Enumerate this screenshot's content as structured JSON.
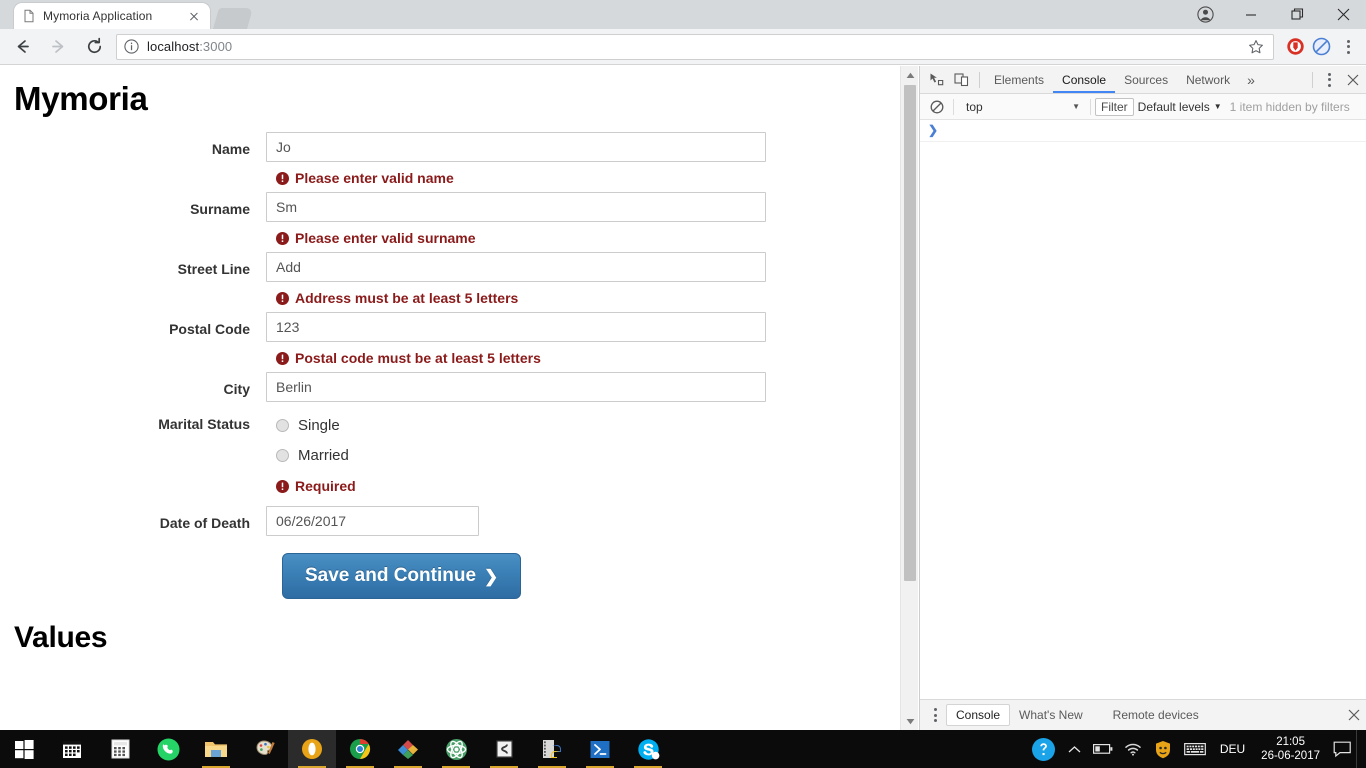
{
  "browser": {
    "tab": {
      "title": "Mymoria Application",
      "favicon_icon": "document-icon",
      "close_icon": "close-icon"
    },
    "new_tab_icon": "new-tab-icon",
    "window_controls": {
      "profile_icon": "profile-avatar-icon",
      "minimize_icon": "minimize-icon",
      "maximize_icon": "maximize-restore-icon",
      "close_icon": "window-close-icon"
    },
    "nav": {
      "back_icon": "back-arrow-icon",
      "forward_icon": "forward-arrow-icon",
      "reload_icon": "reload-icon"
    },
    "omnibox": {
      "info_icon": "page-info-icon",
      "url_host": "localhost",
      "url_port": ":3000",
      "bookmark_icon": "star-icon"
    },
    "extensions": [
      {
        "name": "adblock-extension-icon",
        "color": "#d93025"
      },
      {
        "name": "blocker-extension-icon",
        "color": "#4a7fd4"
      }
    ],
    "menu_icon": "chrome-menu-icon"
  },
  "page": {
    "title": "Mymoria",
    "section_title": "Values",
    "form": {
      "fields": [
        {
          "label": "Name",
          "value": "Jo",
          "error": "Please enter valid name",
          "type": "text"
        },
        {
          "label": "Surname",
          "value": "Sm",
          "error": "Please enter valid surname",
          "type": "text"
        },
        {
          "label": "Street Line",
          "value": "Add",
          "error": "Address must be at least 5 letters",
          "type": "text"
        },
        {
          "label": "Postal Code",
          "value": "123",
          "error": "Postal code must be at least 5 letters",
          "type": "text"
        },
        {
          "label": "City",
          "value": "Berlin",
          "error": "",
          "type": "text"
        }
      ],
      "marital": {
        "label": "Marital Status",
        "options": [
          {
            "label": "Single",
            "selected": false
          },
          {
            "label": "Married",
            "selected": false
          }
        ],
        "error": "Required"
      },
      "date_field": {
        "label": "Date of Death",
        "value": "06/26/2017"
      },
      "submit": {
        "label": "Save and Continue",
        "chevron": "❯"
      },
      "error_icon": "error-exclamation-icon"
    },
    "scrollbar": {
      "up_icon": "scroll-up-arrow-icon",
      "down_icon": "scroll-down-arrow-icon"
    }
  },
  "devtools": {
    "inspect_icon": "inspect-element-icon",
    "device_icon": "toggle-device-toolbar-icon",
    "tabs": [
      {
        "label": "Elements",
        "active": false
      },
      {
        "label": "Console",
        "active": true
      },
      {
        "label": "Sources",
        "active": false
      },
      {
        "label": "Network",
        "active": false
      }
    ],
    "more_tabs_icon": "chevron-double-right-icon",
    "settings_icon": "devtools-menu-icon",
    "close_icon": "devtools-close-icon",
    "console_bar": {
      "clear_icon": "clear-console-icon",
      "context": "top",
      "context_caret": "▼",
      "filter_placeholder": "Filter",
      "levels_label": "Default levels",
      "levels_caret": "▼",
      "hidden_message": "1 item hidden by filters"
    },
    "prompt_caret": "❯",
    "drawer": {
      "menu_icon": "drawer-menu-icon",
      "tabs": [
        {
          "label": "Console",
          "active": true
        },
        {
          "label": "What's New",
          "active": false
        },
        {
          "label": "Remote devices",
          "active": false
        }
      ],
      "close_icon": "drawer-close-icon"
    }
  },
  "taskbar": {
    "start_icon": "windows-start-icon",
    "apps": [
      {
        "name": "calendar-icon",
        "running": false,
        "active": false
      },
      {
        "name": "calculator-icon",
        "running": false,
        "active": false
      },
      {
        "name": "whatsapp-icon",
        "running": false,
        "active": false
      },
      {
        "name": "file-explorer-icon",
        "running": true,
        "active": false
      },
      {
        "name": "paint-icon",
        "running": false,
        "active": false
      },
      {
        "name": "browser-amber-icon",
        "running": true,
        "active": true
      },
      {
        "name": "google-chrome-icon",
        "running": true,
        "active": false
      },
      {
        "name": "diamond-app-icon",
        "running": true,
        "active": false
      },
      {
        "name": "atom-editor-icon",
        "running": true,
        "active": false
      },
      {
        "name": "sublime-text-icon",
        "running": true,
        "active": false
      },
      {
        "name": "python-app-icon",
        "running": true,
        "active": false
      },
      {
        "name": "powershell-icon",
        "running": true,
        "active": false
      },
      {
        "name": "skype-icon",
        "running": true,
        "active": false
      }
    ],
    "tray": {
      "help_icon": "help-question-icon",
      "expand_icon": "show-hidden-icons-icon",
      "battery_icon": "battery-icon",
      "wifi_icon": "wifi-icon",
      "firewall_icon": "firewall-shield-icon",
      "keyboard_icon": "keyboard-icon",
      "language": "DEU",
      "time": "21:05",
      "date": "26-06-2017",
      "notification_icon": "action-center-icon"
    }
  },
  "colors": {
    "error_red": "#8b1a1a",
    "button_blue": "#2e6da4",
    "devtools_accent": "#4285f4",
    "taskbar_bg": "#0b0b0b"
  }
}
